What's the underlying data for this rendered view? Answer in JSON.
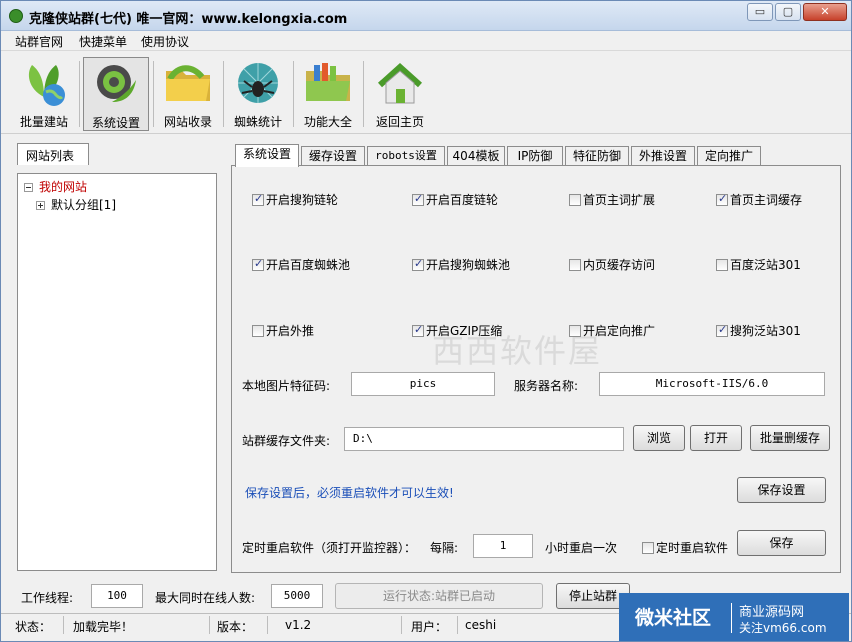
{
  "window": {
    "title": "克隆侠站群(七代)  唯一官网：www.kelongxia.com",
    "controls": {
      "minimize": "▭",
      "maximize": "▢",
      "close": "✕"
    }
  },
  "menu": [
    "站群官网",
    "快捷菜单",
    "使用协议"
  ],
  "toolbar": [
    {
      "label": "批量建站",
      "icon": "earth-plant-icon"
    },
    {
      "label": "系统设置",
      "icon": "gear-icon"
    },
    {
      "label": "网站收录",
      "icon": "folder-icon"
    },
    {
      "label": "蜘蛛统计",
      "icon": "spider-icon"
    },
    {
      "label": "功能大全",
      "icon": "folder-books-icon"
    },
    {
      "label": "返回主页",
      "icon": "home-icon"
    }
  ],
  "site_panel": {
    "tab": "网站列表",
    "tree": {
      "root": "我的网站",
      "child": "默认分组[1]"
    }
  },
  "tabs": [
    "系统设置",
    "缓存设置",
    "robots设置",
    "404模板",
    "IP防御",
    "特征防御",
    "外推设置",
    "定向推广"
  ],
  "options": [
    {
      "label": "开启搜狗链轮",
      "checked": true
    },
    {
      "label": "开启百度链轮",
      "checked": true
    },
    {
      "label": "首页主词扩展",
      "checked": false
    },
    {
      "label": "首页主词缓存",
      "checked": true
    },
    {
      "label": "开启百度蜘蛛池",
      "checked": true
    },
    {
      "label": "开启搜狗蜘蛛池",
      "checked": true
    },
    {
      "label": "内页缓存访问",
      "checked": false
    },
    {
      "label": "百度泛站301",
      "checked": false
    },
    {
      "label": "开启外推",
      "checked": false
    },
    {
      "label": "开启GZIP压缩",
      "checked": true
    },
    {
      "label": "开启定向推广",
      "checked": false
    },
    {
      "label": "搜狗泛站301",
      "checked": true
    }
  ],
  "image_code": {
    "label": "本地图片特征码:",
    "value": "pics"
  },
  "server_name": {
    "label": "服务器名称:",
    "value": "Microsoft-IIS/6.0"
  },
  "cache_folder": {
    "label": "站群缓存文件夹:",
    "value": "D:\\"
  },
  "buttons": {
    "browse": "浏览",
    "open": "打开",
    "batch_delete": "批量删缓存",
    "save_settings": "保存设置",
    "save": "保存"
  },
  "notice": "保存设置后，必须重启软件才可以生效!",
  "restart": {
    "label": "定时重启软件（须打开监控器）：",
    "every_label": "每隔:",
    "hours": "1",
    "unit": "小时重启一次",
    "checkbox_label": "定时重启软件",
    "checked": false
  },
  "watermark": "西西软件屋",
  "bottom": {
    "threads_label": "工作线程:",
    "threads": "100",
    "max_online_label": "最大同时在线人数:",
    "max_online": "5000",
    "run_status": "运行状态:站群已启动",
    "stop_button": "停止站群"
  },
  "status_bar": {
    "status_label": "状态：",
    "status_value": "加载完毕！",
    "version_label": "版本：",
    "version_value": "v1.2",
    "user_label": "用户：",
    "user_value": "ceshi"
  },
  "badge": {
    "main": "微米社区",
    "line1": "商业源码网",
    "line2": "关注vm66.com"
  }
}
